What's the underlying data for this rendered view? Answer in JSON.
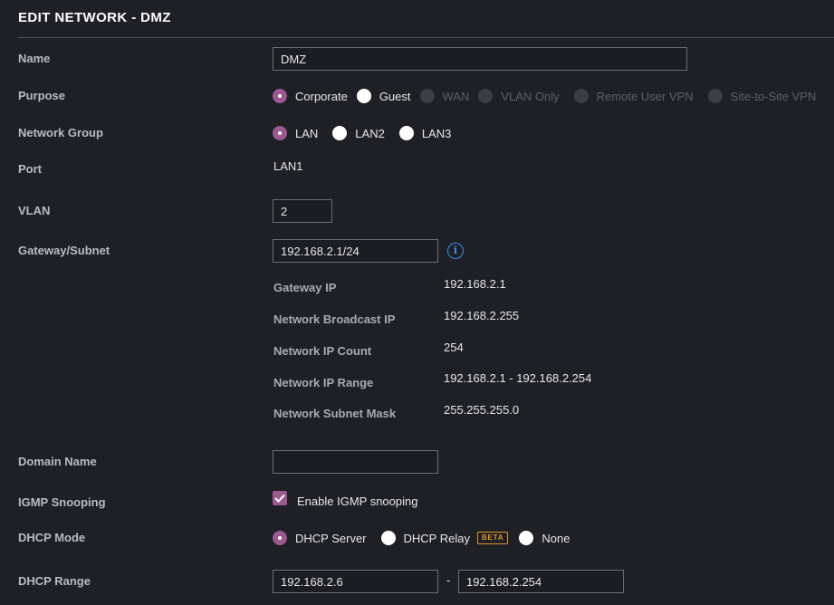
{
  "header": {
    "title": "EDIT NETWORK - DMZ"
  },
  "form": {
    "name": {
      "label": "Name",
      "value": "DMZ"
    },
    "purpose": {
      "label": "Purpose",
      "options": [
        {
          "label": "Corporate",
          "selected": true,
          "disabled": false
        },
        {
          "label": "Guest",
          "selected": false,
          "disabled": false
        },
        {
          "label": "WAN",
          "selected": false,
          "disabled": true
        },
        {
          "label": "VLAN Only",
          "selected": false,
          "disabled": true
        },
        {
          "label": "Remote User VPN",
          "selected": false,
          "disabled": true
        },
        {
          "label": "Site-to-Site VPN",
          "selected": false,
          "disabled": true
        }
      ]
    },
    "network_group": {
      "label": "Network Group",
      "options": [
        {
          "label": "LAN",
          "selected": true
        },
        {
          "label": "LAN2",
          "selected": false
        },
        {
          "label": "LAN3",
          "selected": false
        }
      ]
    },
    "port": {
      "label": "Port",
      "value": "LAN1"
    },
    "vlan": {
      "label": "VLAN",
      "value": "2"
    },
    "gateway_subnet": {
      "label": "Gateway/Subnet",
      "value": "192.168.2.1/24",
      "info_icon": "info-icon",
      "details": [
        {
          "label": "Gateway IP",
          "value": "192.168.2.1"
        },
        {
          "label": "Network Broadcast IP",
          "value": "192.168.2.255"
        },
        {
          "label": "Network IP Count",
          "value": "254"
        },
        {
          "label": "Network IP Range",
          "value": "192.168.2.1 - 192.168.2.254"
        },
        {
          "label": "Network Subnet Mask",
          "value": "255.255.255.0"
        }
      ]
    },
    "domain_name": {
      "label": "Domain Name",
      "value": ""
    },
    "igmp_snooping": {
      "label": "IGMP Snooping",
      "checkbox_label": "Enable IGMP snooping",
      "checked": true
    },
    "dhcp_mode": {
      "label": "DHCP Mode",
      "options": [
        {
          "label": "DHCP Server",
          "selected": true
        },
        {
          "label": "DHCP Relay",
          "selected": false,
          "badge": "BETA"
        },
        {
          "label": "None",
          "selected": false
        }
      ]
    },
    "dhcp_range": {
      "label": "DHCP Range",
      "start": "192.168.2.6",
      "separator": "-",
      "end": "192.168.2.254"
    }
  },
  "colors": {
    "accent": "#9b5a8f",
    "info": "#3b8ff2",
    "beta": "#e0952e",
    "background": "#1e2026"
  }
}
